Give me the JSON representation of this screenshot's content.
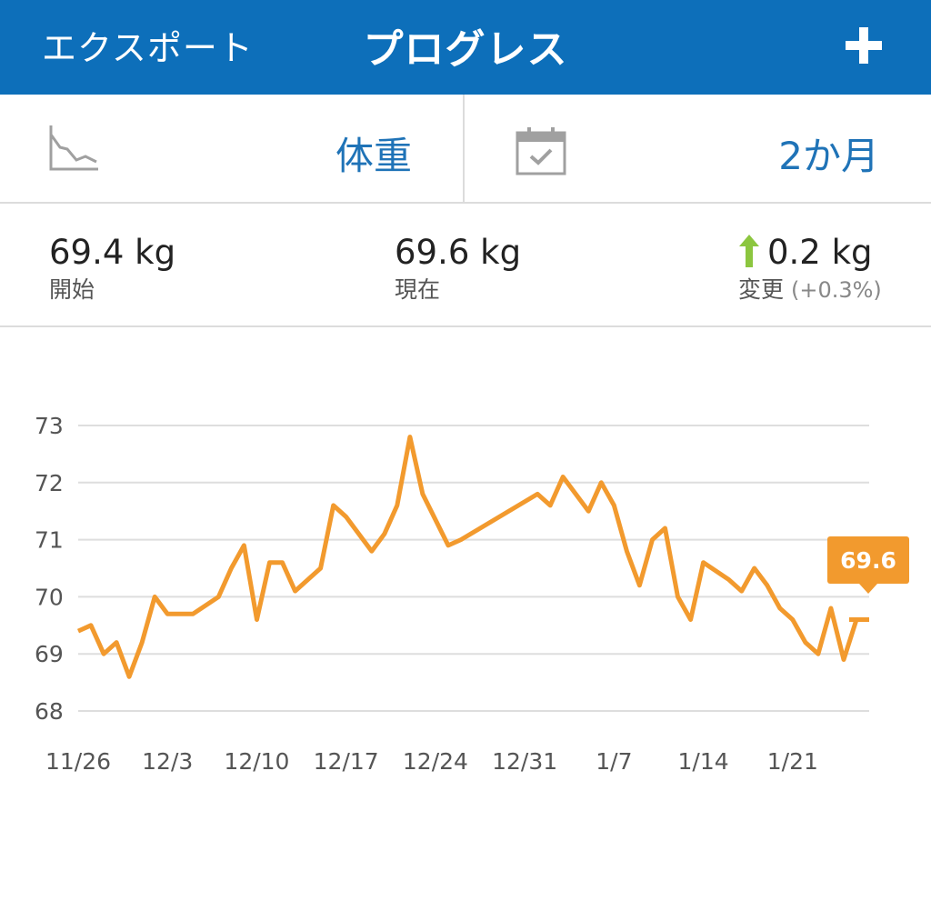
{
  "header": {
    "export_label": "エクスポート",
    "title": "プログレス",
    "add_label": "+"
  },
  "selectors": {
    "metric": {
      "icon": "trend-chart-icon",
      "value": "体重"
    },
    "period": {
      "icon": "calendar-check-icon",
      "value": "2か月"
    }
  },
  "stats": {
    "start": {
      "value": "69.4 kg",
      "label": "開始"
    },
    "current": {
      "value": "69.6 kg",
      "label": "現在"
    },
    "change": {
      "value": "0.2 kg",
      "label": "変更",
      "percent": "(+0.3%)",
      "direction": "up",
      "arrow_color": "#8cc63f"
    }
  },
  "colors": {
    "header_bg": "#0d6fba",
    "accent_text": "#1f73b7",
    "line": "#f29a2e",
    "grid": "#dedede"
  },
  "chart_data": {
    "type": "line",
    "ylim": [
      68,
      73
    ],
    "yticks": [
      "73",
      "72",
      "71",
      "70",
      "69",
      "68"
    ],
    "xticks": [
      "11/26",
      "12/3",
      "12/10",
      "12/17",
      "12/24",
      "12/31",
      "1/7",
      "1/14",
      "1/21"
    ],
    "grid": true,
    "callout": "69.6",
    "series": [
      {
        "x": [
          "11/26",
          "11/27",
          "11/28",
          "11/29",
          "11/30",
          "12/1",
          "12/2",
          "12/3",
          "12/5",
          "12/7",
          "12/8",
          "12/9",
          "12/10",
          "12/11",
          "12/12",
          "12/13",
          "12/15",
          "12/16",
          "12/17",
          "12/19",
          "12/20",
          "12/21",
          "12/22",
          "12/23",
          "12/25",
          "12/26",
          "1/1",
          "1/2",
          "1/3",
          "1/5",
          "1/6",
          "1/7",
          "1/8",
          "1/9",
          "1/10",
          "1/11",
          "1/12",
          "1/13",
          "1/14",
          "1/16",
          "1/17",
          "1/18",
          "1/19",
          "1/20",
          "1/21",
          "1/22",
          "1/23",
          "1/24",
          "1/25",
          "1/26"
        ],
        "values": [
          69.4,
          69.5,
          69.0,
          69.2,
          68.6,
          69.2,
          70.0,
          69.7,
          69.7,
          70.0,
          70.5,
          70.9,
          69.6,
          70.6,
          70.6,
          70.1,
          70.5,
          71.6,
          71.4,
          70.8,
          71.1,
          71.6,
          72.8,
          71.8,
          70.9,
          71.0,
          71.8,
          71.6,
          72.1,
          71.5,
          72.0,
          71.6,
          70.8,
          70.2,
          71.0,
          71.2,
          70.0,
          69.6,
          70.6,
          70.3,
          70.1,
          70.5,
          70.2,
          69.8,
          69.6,
          69.2,
          69.0,
          69.8,
          68.9,
          69.6
        ]
      }
    ]
  }
}
